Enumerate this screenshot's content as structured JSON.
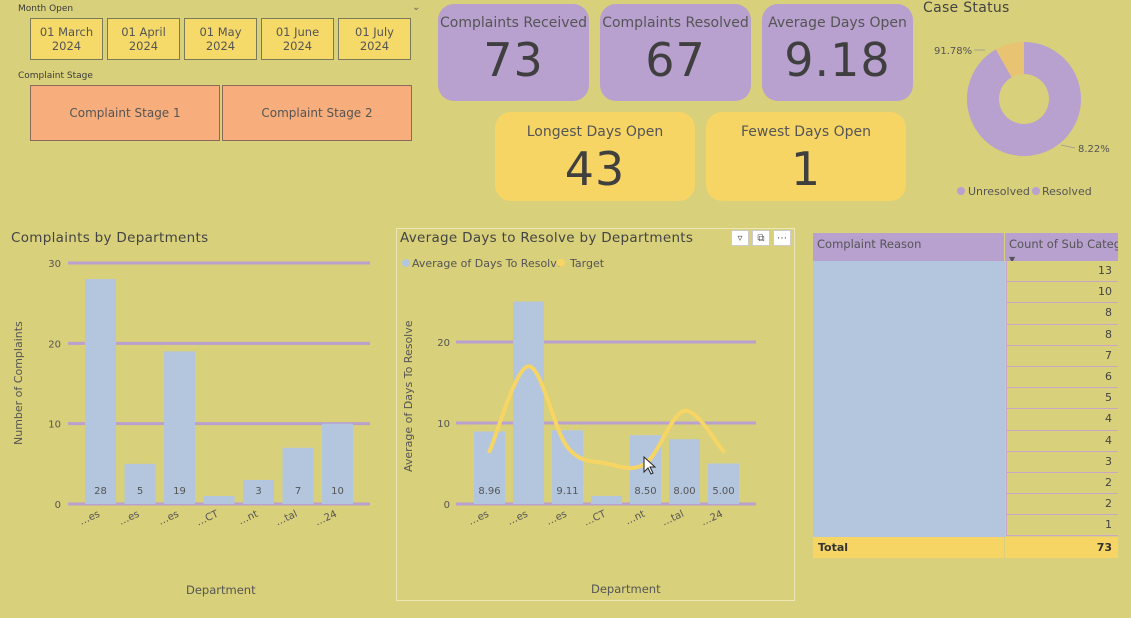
{
  "slicers": {
    "month_title": "Month Open",
    "months": [
      {
        "line1": "01 March",
        "line2": "2024"
      },
      {
        "line1": "01 April",
        "line2": "2024"
      },
      {
        "line1": "01 May",
        "line2": "2024"
      },
      {
        "line1": "01 June",
        "line2": "2024"
      },
      {
        "line1": "01 July",
        "line2": "2024"
      }
    ],
    "stage_title": "Complaint Stage",
    "stages": [
      "Complaint Stage 1",
      "Complaint Stage 2"
    ]
  },
  "kpis": {
    "received": {
      "label": "Complaints Received",
      "value": "73"
    },
    "resolved": {
      "label": "Complaints Resolved",
      "value": "67"
    },
    "avg_days": {
      "label": "Average Days Open",
      "value": "9.18"
    },
    "longest": {
      "label": "Longest Days Open",
      "value": "43"
    },
    "fewest": {
      "label": "Fewest Days Open",
      "value": "1"
    }
  },
  "case_status": {
    "title": "Case Status",
    "label_big": "91.78%",
    "label_small": "8.22%",
    "legend": [
      "Unresolved",
      "Resolved"
    ],
    "colors": {
      "Unresolved": "#b8a0cf",
      "Resolved": "#e8c372"
    }
  },
  "chart_data": [
    {
      "type": "bar",
      "title": "Complaints by Departments",
      "xlabel": "Department",
      "ylabel": "Number of Complaints",
      "ylim": [
        0,
        30
      ],
      "yticks": [
        "0",
        "10",
        "20",
        "30"
      ],
      "categories": [
        "…es",
        "…es",
        "…es",
        "…CT",
        "…nt",
        "…tal",
        "…24"
      ],
      "values": [
        28,
        5,
        19,
        1,
        3,
        7,
        10
      ],
      "labels": [
        "28",
        "5",
        "19",
        "",
        "3",
        "7",
        "10"
      ],
      "bar_color": "#b4c6de",
      "grid_color": "#b8a0cf"
    },
    {
      "type": "bar",
      "title": "Average Days to Resolve by Departments",
      "xlabel": "Department",
      "ylabel": "Average of Days To Resolve",
      "ylim": [
        0,
        25
      ],
      "yticks": [
        "0",
        "10",
        "20"
      ],
      "legend": [
        "Average of Days To Resolve",
        "Target"
      ],
      "categories": [
        "…es",
        "…es",
        "…es",
        "…CT",
        "…nt",
        "…tal",
        "…24"
      ],
      "values": [
        8.96,
        25,
        9.11,
        1,
        8.5,
        8.0,
        5.0
      ],
      "labels": [
        "8.96",
        "",
        "9.11",
        "",
        "8.50",
        "8.00",
        "5.00"
      ],
      "target": [
        6.5,
        17,
        7,
        5,
        5,
        11.5,
        6.5
      ],
      "bar_color": "#b4c6de",
      "line_color": "#f7d565",
      "grid_color": "#b8a0cf"
    }
  ],
  "table": {
    "col1": "Complaint Reason",
    "col2": "Count of Sub Categ",
    "rows": [
      "13",
      "10",
      "8",
      "8",
      "7",
      "6",
      "5",
      "4",
      "4",
      "3",
      "2",
      "2",
      "1"
    ],
    "total_label": "Total",
    "total_value": "73"
  }
}
